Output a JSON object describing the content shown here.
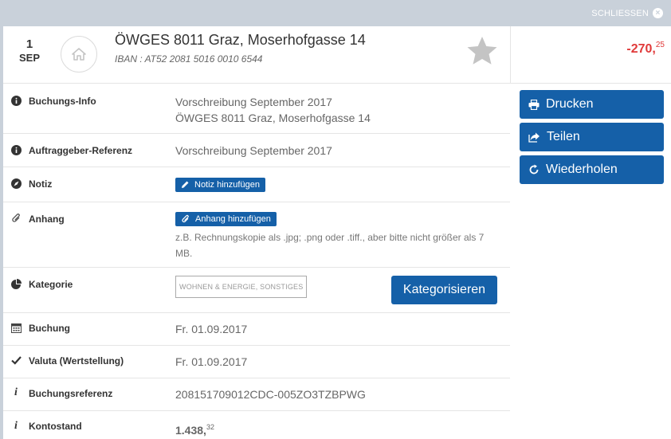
{
  "topbar": {
    "close_label": "SCHLIESSEN"
  },
  "header": {
    "day": "1",
    "month": "SEP",
    "title": "ÖWGES 8011 Graz, Moserhofgasse 14",
    "iban": "IBAN : AT52 2081 5016 0010 6544",
    "amount_main": "-270,",
    "amount_cents": "25"
  },
  "details": {
    "buchungsinfo": {
      "label": "Buchungs-Info",
      "line1": "Vorschreibung September 2017",
      "line2": "ÖWGES 8011 Graz, Moserhofgasse 14"
    },
    "referenz": {
      "label": "Auftraggeber-Referenz",
      "value": "Vorschreibung September 2017"
    },
    "notiz": {
      "label": "Notiz",
      "button": "Notiz hinzufügen"
    },
    "anhang": {
      "label": "Anhang",
      "button": "Anhang hinzufügen",
      "hint": "z.B. Rechnungskopie als .jpg; .png oder .tiff., aber bitte nicht größer als 7 MB."
    },
    "kategorie": {
      "label": "Kategorie",
      "tag": "WOHNEN & ENERGIE, SONSTIGES",
      "button": "Kategorisieren"
    },
    "buchung": {
      "label": "Buchung",
      "value": "Fr. 01.09.2017"
    },
    "valuta": {
      "label": "Valuta (Wertstellung)",
      "value": "Fr. 01.09.2017"
    },
    "buchungsreferenz": {
      "label": "Buchungsreferenz",
      "value": "208151709012CDC-005ZO3TZBPWG"
    },
    "kontostand": {
      "label": "Kontostand",
      "main": "1.438,",
      "cents": "32"
    }
  },
  "actions": {
    "print": "Drucken",
    "share": "Teilen",
    "repeat": "Wiederholen"
  },
  "colors": {
    "primary": "#1560a8",
    "negative": "#e03a3a",
    "positive": "#2f9e3a",
    "frame": "#c9d1da"
  }
}
